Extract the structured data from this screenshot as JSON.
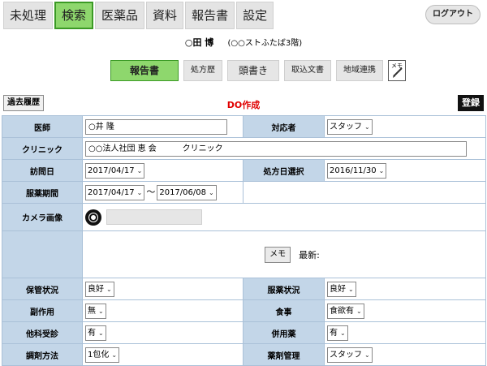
{
  "nav": {
    "tabs": [
      {
        "label": "未処理"
      },
      {
        "label": "検索"
      },
      {
        "label": "医薬品"
      },
      {
        "label": "資料"
      },
      {
        "label": "報告書"
      },
      {
        "label": "設定"
      }
    ],
    "active_tab": "検索",
    "logout_label": "ログアウト"
  },
  "patient": {
    "name": "○田 博",
    "reading": "(○○ストふたば3階)"
  },
  "subtabs": {
    "report": "報告書",
    "prescription_history": "処方歴",
    "header_note": "頭書き",
    "imported_docs": "取込文書",
    "regional": "地域連携",
    "memo_icon": "メモ"
  },
  "actions": {
    "past_history": "過去履歴",
    "title": "DO作成",
    "register": "登録"
  },
  "form": {
    "doctor": {
      "label": "医師",
      "value": "○井 隆"
    },
    "responder": {
      "label": "対応者",
      "value": "スタッフ"
    },
    "clinic": {
      "label": "クリニック",
      "value": "○○法人社団 恵 会          クリニック"
    },
    "visit_date": {
      "label": "訪問日",
      "value": "2017/04/17"
    },
    "prescription_date": {
      "label": "処方日選択",
      "value": "2016/11/30"
    },
    "medication_period": {
      "label": "服薬期間",
      "from": "2017/04/17",
      "tilde": "〜",
      "to": "2017/06/08"
    },
    "camera": {
      "label": "カメラ画像"
    },
    "memo": {
      "button": "メモ",
      "latest": "最新:"
    },
    "storage": {
      "label": "保管状況",
      "value": "良好"
    },
    "med_status": {
      "label": "服薬状況",
      "value": "良好"
    },
    "side_effects": {
      "label": "副作用",
      "value": "無"
    },
    "meals": {
      "label": "食事",
      "value": "食欲有"
    },
    "other_clinic": {
      "label": "他科受診",
      "value": "有"
    },
    "concomitant": {
      "label": "併用薬",
      "value": "有"
    },
    "dispensing": {
      "label": "調剤方法",
      "value": "1包化"
    },
    "drug_mgmt": {
      "label": "薬剤管理",
      "value": "スタッフ"
    }
  },
  "colors": {
    "active_tab": "#8ed76d",
    "label_bg": "#c3d6e8",
    "title_red": "#e00000"
  }
}
